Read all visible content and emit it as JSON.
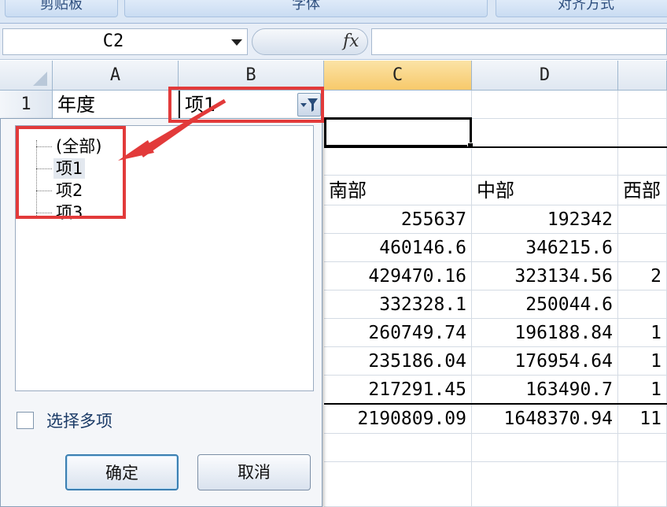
{
  "ribbon": {
    "groups": [
      "剪贴板",
      "字体",
      "对齐方式"
    ]
  },
  "formula_bar": {
    "name_box": "C2",
    "fx_label": "fx",
    "formula": ""
  },
  "columns": [
    "A",
    "B",
    "C",
    "D"
  ],
  "rows": {
    "row1_num": "1",
    "row1_a": "年度",
    "row1_b": "项1"
  },
  "table": {
    "headers": [
      "南部",
      "中部",
      "西部"
    ],
    "rows": [
      [
        "255637",
        "192342",
        ""
      ],
      [
        "460146.6",
        "346215.6",
        ""
      ],
      [
        "429470.16",
        "323134.56",
        "2"
      ],
      [
        "332328.1",
        "250044.6",
        ""
      ],
      [
        "260749.74",
        "196188.84",
        "1"
      ],
      [
        "235186.04",
        "176954.64",
        "1"
      ],
      [
        "217291.45",
        "163490.7",
        "1"
      ]
    ],
    "totals": [
      "2190809.09",
      "1648370.94",
      "11"
    ]
  },
  "filter_popup": {
    "items": [
      "(全部)",
      "项1",
      "项2",
      "项3"
    ],
    "selected_index": 1,
    "multi_select_label": "选择多项",
    "multi_select_checked": false,
    "ok_label": "确定",
    "cancel_label": "取消"
  },
  "colors": {
    "annotation_red": "#e23a3a",
    "active_column_header": "#f7c96b"
  }
}
